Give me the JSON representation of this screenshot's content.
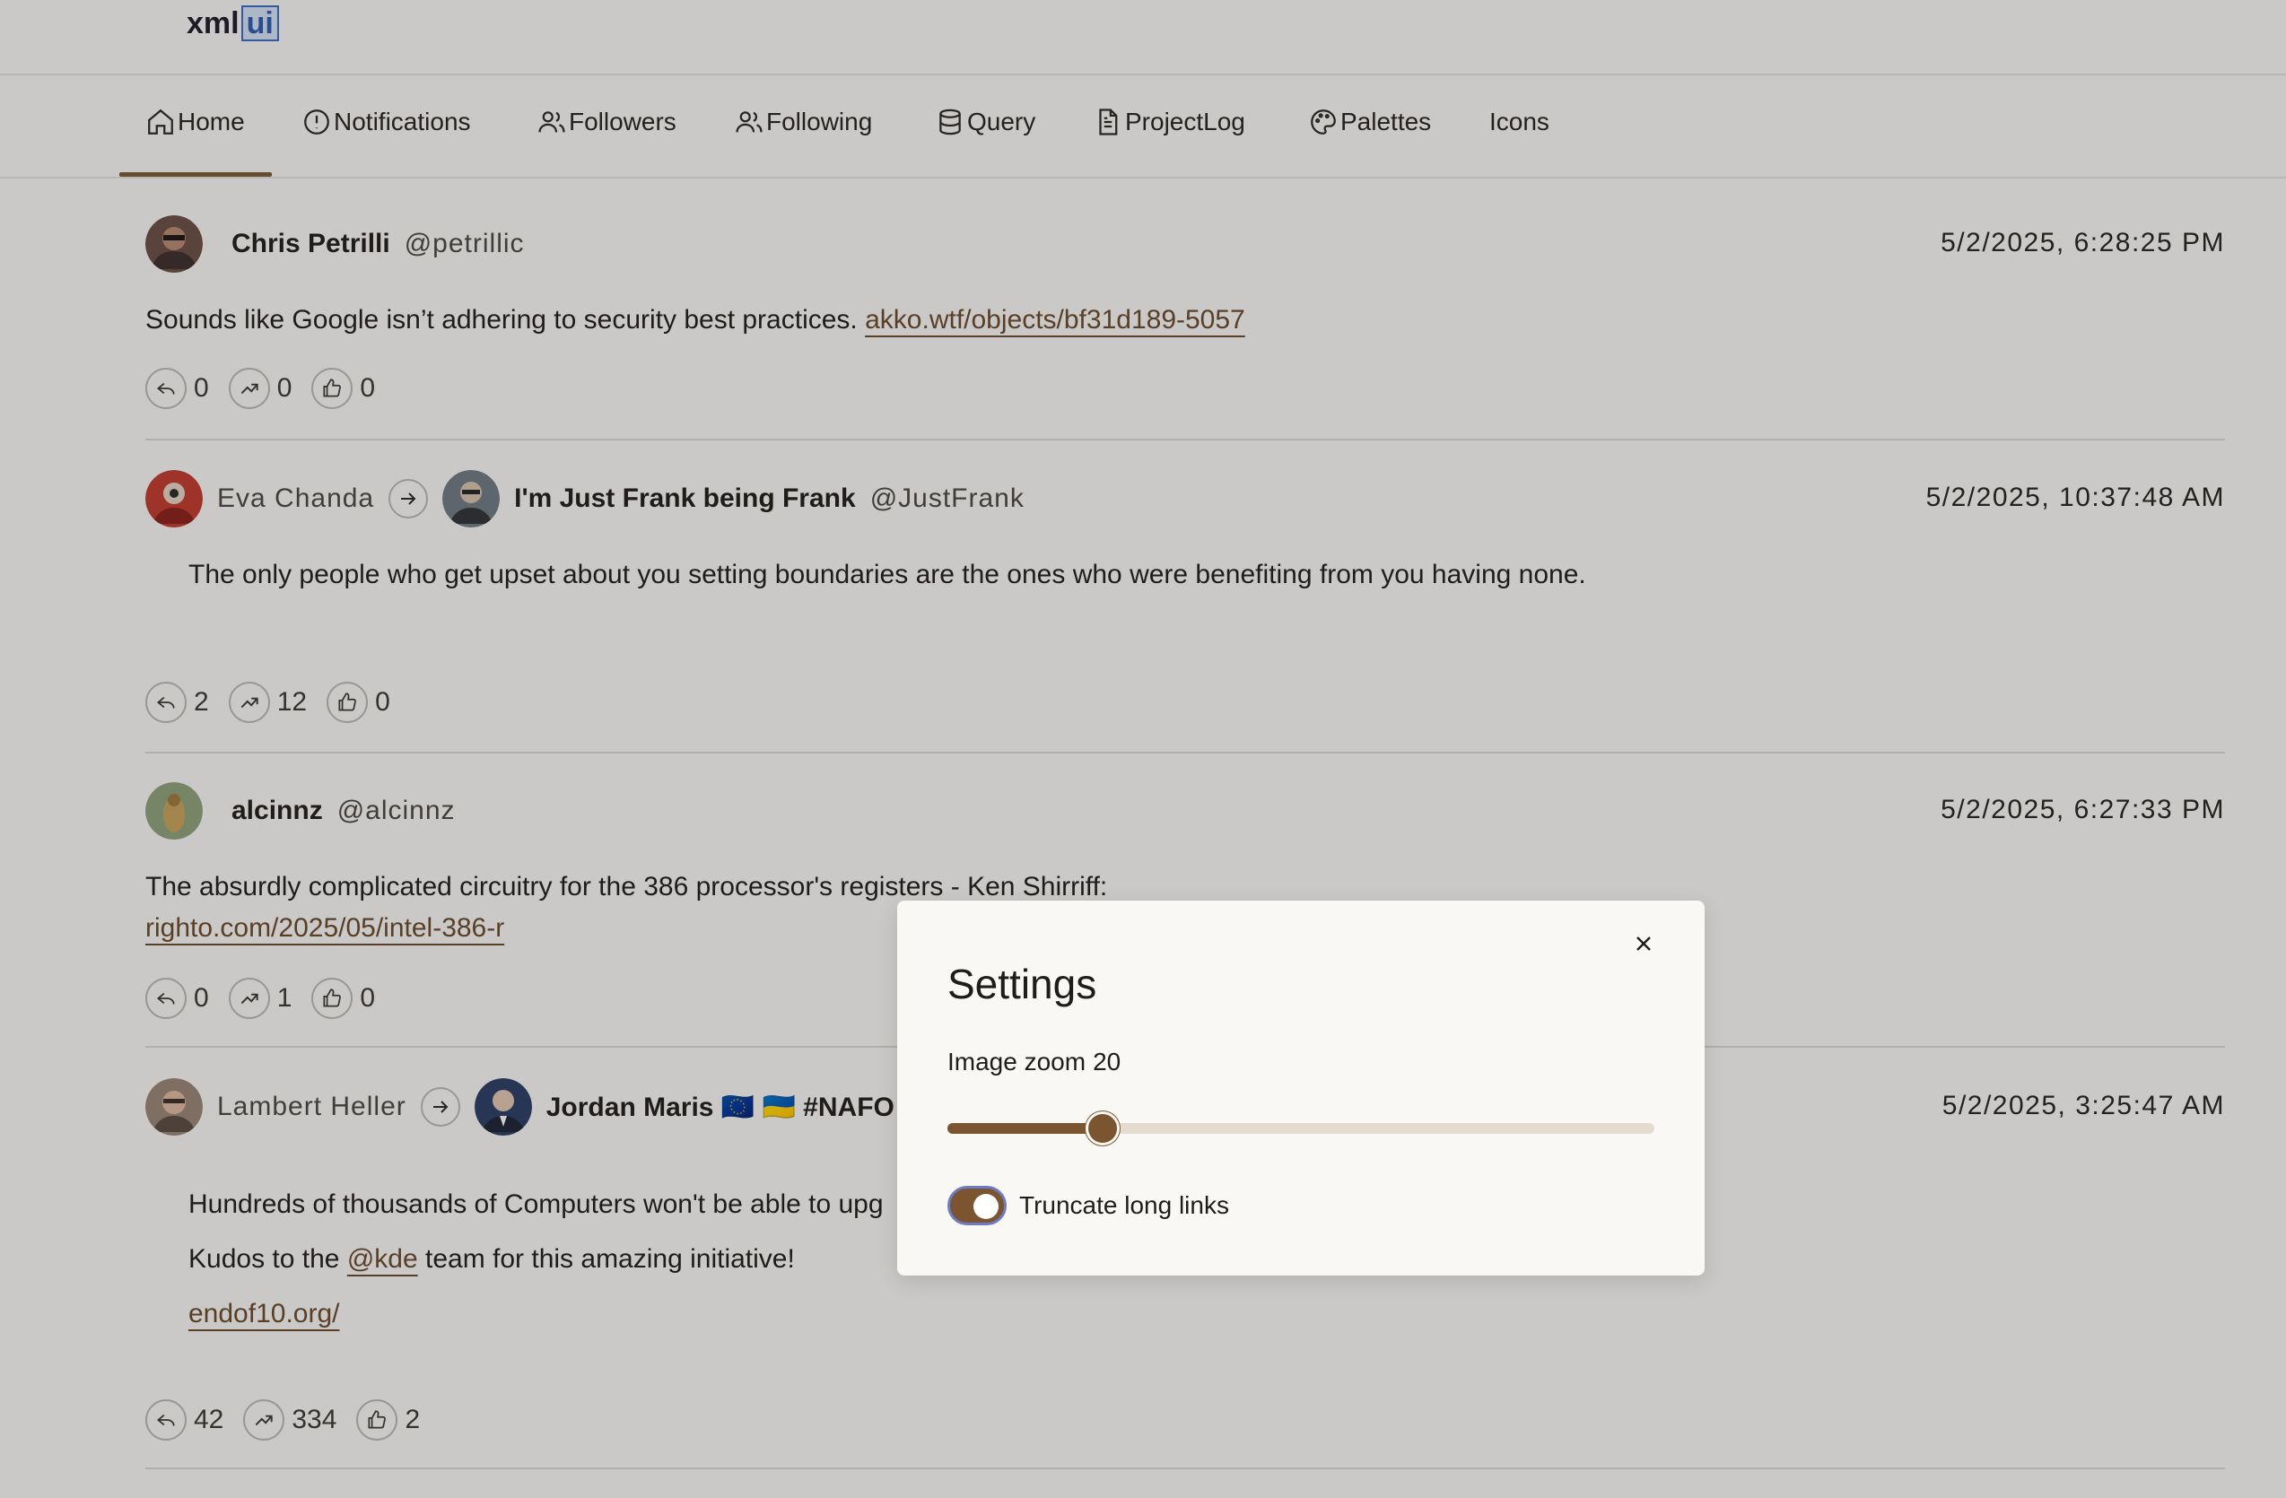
{
  "logo": {
    "text": "xml",
    "accent": "ui"
  },
  "nav": {
    "items": [
      {
        "label": "Home",
        "icon": "home-icon"
      },
      {
        "label": "Notifications",
        "icon": "alert-circle-icon"
      },
      {
        "label": "Followers",
        "icon": "users-icon"
      },
      {
        "label": "Following",
        "icon": "users-icon"
      },
      {
        "label": "Query",
        "icon": "database-icon"
      },
      {
        "label": "ProjectLog",
        "icon": "document-icon"
      },
      {
        "label": "Palettes",
        "icon": "palette-icon"
      },
      {
        "label": "Icons",
        "icon": ""
      }
    ],
    "active": "Home"
  },
  "posts": [
    {
      "author": "Chris Petrilli",
      "handle": "@petrillic",
      "time": "5/2/2025, 6:28:25 PM",
      "text": "Sounds like Google isn’t adhering to security best practices.",
      "link": "akko.wtf/objects/bf31d189-5057",
      "replies": "0",
      "boosts": "0",
      "likes": "0"
    },
    {
      "booster": "Eva Chanda",
      "author": "I'm Just Frank being Frank",
      "handle": "@JustFrank",
      "time": "5/2/2025, 10:37:48 AM",
      "text": "The only people who get upset about you setting boundaries are the ones who were benefiting from you having none.",
      "replies": "2",
      "boosts": "12",
      "likes": "0"
    },
    {
      "author": "alcinnz",
      "handle": "@alcinnz",
      "time": "5/2/2025, 6:27:33 PM",
      "text": "The absurdly complicated circuitry for the 386 processor's registers - Ken Shirriff:",
      "link": "righto.com/2025/05/intel-386-r",
      "replies": "0",
      "boosts": "1",
      "likes": "0"
    },
    {
      "booster": "Lambert Heller",
      "author": "Jordan Maris 🇪🇺 🇺🇦 #NAFO",
      "time": "5/2/2025, 3:25:47 AM",
      "line1": "Hundreds of thousands of Computers won't be able to upg",
      "line2_pre": "Kudos to the",
      "line2_mention": "@kde",
      "line2_post": "team for this amazing initiative!",
      "link": "endof10.org/",
      "replies": "42",
      "boosts": "334",
      "likes": "2"
    }
  ],
  "settings": {
    "title": "Settings",
    "zoom_label": "Image zoom",
    "zoom_value": "20",
    "zoom_fraction": 0.22,
    "truncate_label": "Truncate long links",
    "truncate_on": true
  },
  "colors": {
    "accent": "#7a5530",
    "link": "#6b4a2b",
    "background": "#fafaf8"
  }
}
